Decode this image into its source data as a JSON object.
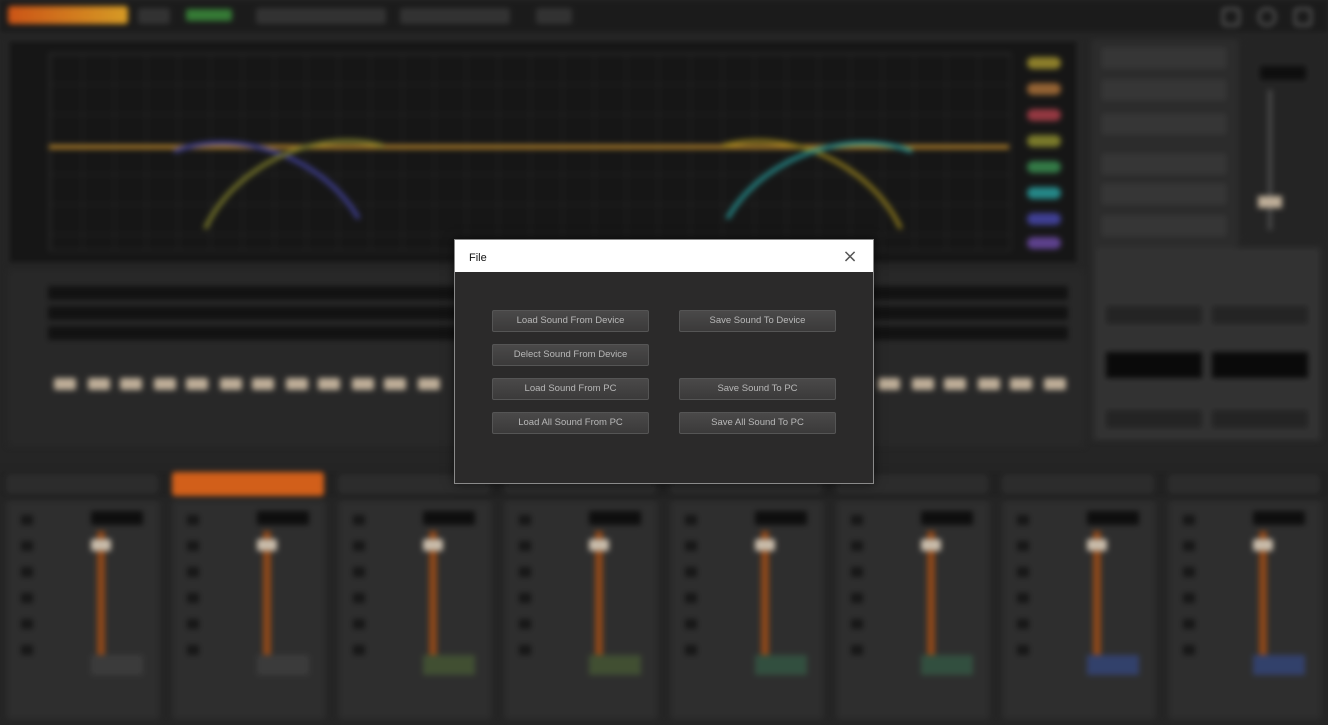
{
  "dialog": {
    "title": "File",
    "close_glyph": "×",
    "buttons": {
      "load_from_device": "Load Sound From Device",
      "save_to_device": "Save Sound To Device",
      "delete_from_device": "Delect Sound From Device",
      "load_from_pc": "Load Sound From PC",
      "save_to_pc": "Save Sound To PC",
      "load_all_from_pc": "Load All Sound From PC",
      "save_all_to_pc": "Save All Sound To PC"
    }
  },
  "background": {
    "blurred": true,
    "accent_color": "#ef6d1e",
    "eq_line_color": "#c8902c"
  }
}
